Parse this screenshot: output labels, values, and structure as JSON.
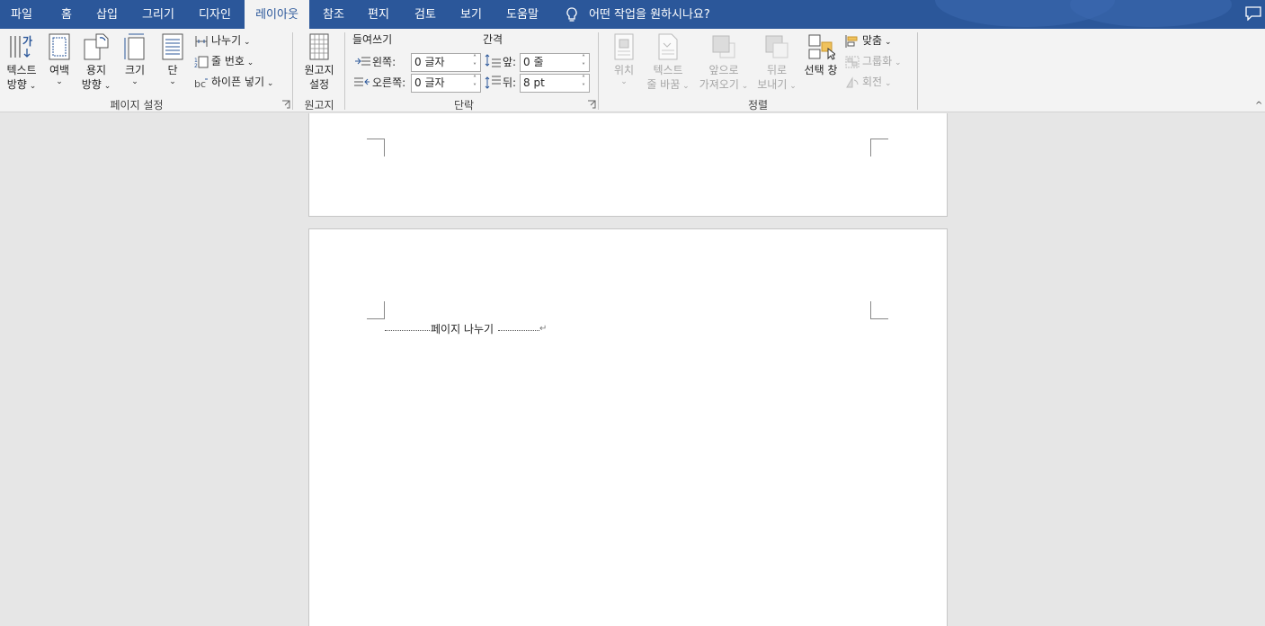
{
  "tabs": {
    "file": "파일",
    "home": "홈",
    "insert": "삽입",
    "draw": "그리기",
    "design": "디자인",
    "layout": "레이아웃",
    "references": "참조",
    "mailings": "편지",
    "review": "검토",
    "view": "보기",
    "help": "도움말"
  },
  "active_tab": "layout",
  "tell_me": "어떤 작업을 원하시나요?",
  "accent_color": "#2b579a",
  "page_setup": {
    "group_label": "페이지 설정",
    "text_direction": [
      "텍스트",
      "방향"
    ],
    "margins": "여백",
    "orientation": [
      "용지",
      "방향"
    ],
    "size": "크기",
    "columns": "단",
    "breaks": "나누기",
    "line_numbers": "줄 번호",
    "hyphenation": "하이픈 넣기"
  },
  "manuscript": {
    "group_label": "원고지",
    "settings": [
      "원고지",
      "설정"
    ]
  },
  "paragraph": {
    "group_label": "단락",
    "indent_header": "들여쓰기",
    "spacing_header": "간격",
    "left_label": "왼쪽:",
    "left_value": "0 글자",
    "right_label": "오른쪽:",
    "right_value": "0 글자",
    "before_label": "앞:",
    "before_value": "0 줄",
    "after_label": "뒤:",
    "after_value": "8 pt"
  },
  "arrange": {
    "group_label": "정렬",
    "position": "위치",
    "wrap_text": [
      "텍스트",
      "줄 바꿈"
    ],
    "bring_forward": [
      "앞으로",
      "가져오기"
    ],
    "send_backward": [
      "뒤로",
      "보내기"
    ],
    "selection_pane": "선택 창",
    "align": "맞춤",
    "group": "그룹화",
    "rotate": "회전"
  },
  "document": {
    "page_break_label": "페이지 나누기"
  }
}
